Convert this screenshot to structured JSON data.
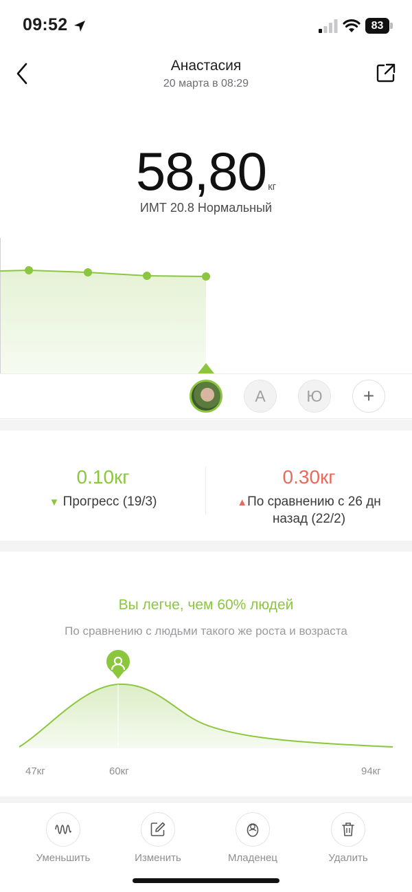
{
  "status_bar": {
    "time": "09:52",
    "battery": "83"
  },
  "nav": {
    "title": "Анастасия",
    "subtitle": "20 марта в 08:29"
  },
  "measurement": {
    "weight": "58,80",
    "unit": "кг",
    "bmi_text": "ИМТ 20.8 Нормальный"
  },
  "users": [
    {
      "label": "",
      "active": true
    },
    {
      "label": "А",
      "active": false
    },
    {
      "label": "Ю",
      "active": false
    },
    {
      "label": "+",
      "active": false
    }
  ],
  "progress": {
    "left_value": "0.10кг",
    "left_arrow": "▼",
    "left_label": "Прогресс (19/3)",
    "right_value": "0.30кг",
    "right_arrow": "▲",
    "right_label": "По сравнению с 26 дн назад (22/2)"
  },
  "distribution": {
    "title": "Вы легче, чем 60% людей",
    "subtitle": "По сравнению с людьми такого же роста и возраста",
    "ticks": {
      "left": "47кг",
      "mid": "60кг",
      "right": "94кг"
    }
  },
  "toolbar": [
    {
      "label": "Уменьшить",
      "icon": "wave-icon"
    },
    {
      "label": "Изменить",
      "icon": "edit-icon"
    },
    {
      "label": "Младенец",
      "icon": "baby-icon"
    },
    {
      "label": "Удалить",
      "icon": "trash-icon"
    }
  ],
  "colors": {
    "accent": "#8cc63f",
    "negative": "#e86a5c",
    "fill": "#eef6e3"
  }
}
